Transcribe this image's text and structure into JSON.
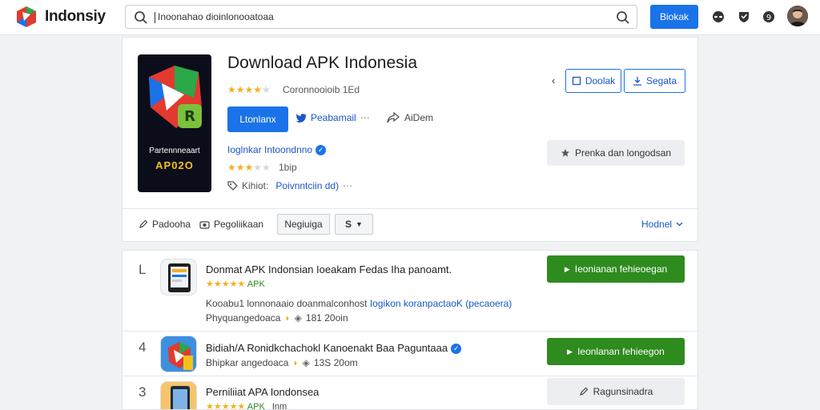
{
  "header": {
    "brand": "Indonsiy",
    "search_value": "Inoonahao dioinlonooatoaa",
    "primary_button": "Biokak",
    "icons": [
      "search-icon",
      "alien-icon",
      "shield-icon",
      "badge-icon"
    ]
  },
  "hero": {
    "title": "Download APK Indonesia",
    "tile_caption": "Partennneaart",
    "tile_code": "AP02O",
    "rating_text": "Coronnooioib 1Ed",
    "install_label": "Ltonlanx",
    "share_label": "Peabamail",
    "share_extra": "⋯",
    "count_label": "AiDem",
    "developer_label": "Ioglnkar Intoondnno",
    "developer_rating_text": "1bip",
    "info_prefix": "Kihiot:",
    "info_link": "Poivnntciin dd)",
    "more_label": "⋯",
    "outline_btn_1": "Doolak",
    "outline_btn_2": "Segata",
    "side_grey_btn": "Prenka dan longodsan",
    "chevron": "‹"
  },
  "toolbar": {
    "item_1": "Padooha",
    "item_2": "Pegoliikaan",
    "item_3": "Negiuiga",
    "item_4": "S",
    "right_link": "Hodnel"
  },
  "list": [
    {
      "rank": "L",
      "title": "Donmat APK Indonsian Ioeakam Fedas Iha panoamt.",
      "rating_text": "APK",
      "desc_prefix": "Kooabu1 lonnonaaio doanmalconhost",
      "desc_link": "Iogikon koranpactaoK (pecaoera)",
      "meta_text": "Phyquangedoaca",
      "meta_count": "181 20oin",
      "button": "Ieonianan fehieoegan",
      "button_style": "green"
    },
    {
      "rank": "4",
      "title": "Bidiah/A Ronidkchachokl Kanoenakt Baa Paguntaaa",
      "meta_text": "Bhipkar angedoaca",
      "meta_count": "13S 20om",
      "button": "Ieonlanan fehieegon",
      "button_style": "green"
    },
    {
      "rank": "3",
      "title": "Perniliiat APA Iondonsea",
      "rating_text": "APK",
      "meta_count": "Inm",
      "button": "Ragunsinadra",
      "button_style": "grey"
    }
  ],
  "colors": {
    "accent_blue": "#1a73e8",
    "install_green": "#2e8b1e",
    "star_yellow": "#f3b022"
  }
}
